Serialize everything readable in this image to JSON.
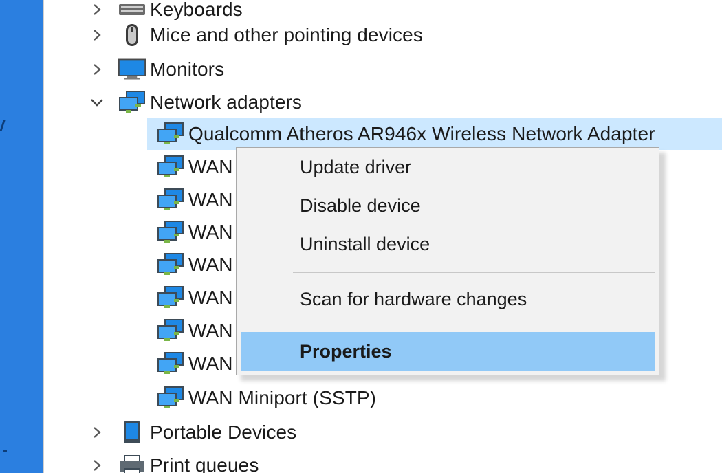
{
  "tree": {
    "rows": [
      {
        "label": "Keyboards",
        "icon": "keyboard-icon",
        "expanded": false
      },
      {
        "label": "Mice and other pointing devices",
        "icon": "mouse-icon",
        "expanded": false
      },
      {
        "label": "Monitors",
        "icon": "monitor-icon",
        "expanded": false
      },
      {
        "label": "Network adapters",
        "icon": "network-adapter-icon",
        "expanded": true
      },
      {
        "label": "Qualcomm Atheros AR946x Wireless Network Adapter",
        "icon": "network-adapter-icon",
        "selected": true
      },
      {
        "label": "WAN",
        "icon": "network-adapter-icon"
      },
      {
        "label": "WAN",
        "icon": "network-adapter-icon"
      },
      {
        "label": "WAN",
        "icon": "network-adapter-icon"
      },
      {
        "label": "WAN",
        "icon": "network-adapter-icon"
      },
      {
        "label": "WAN",
        "icon": "network-adapter-icon"
      },
      {
        "label": "WAN",
        "icon": "network-adapter-icon"
      },
      {
        "label": "WAN",
        "icon": "network-adapter-icon"
      },
      {
        "label": "WAN Miniport (SSTP)",
        "icon": "network-adapter-icon"
      },
      {
        "label": "Portable Devices",
        "icon": "portable-device-icon",
        "expanded": false
      },
      {
        "label": "Print queues",
        "icon": "printer-icon",
        "expanded": false
      }
    ]
  },
  "context_menu": {
    "items": [
      {
        "label": "Update driver"
      },
      {
        "label": "Disable device"
      },
      {
        "label": "Uninstall device"
      },
      {
        "label": "Scan for hardware changes"
      },
      {
        "label": "Properties",
        "highlighted": true,
        "bold": true
      }
    ]
  },
  "colors": {
    "selection": "#cce8ff",
    "menu_highlight": "#91c9f7",
    "menu_background": "#f2f2f2",
    "accent_bar": "#2b7fe0"
  }
}
